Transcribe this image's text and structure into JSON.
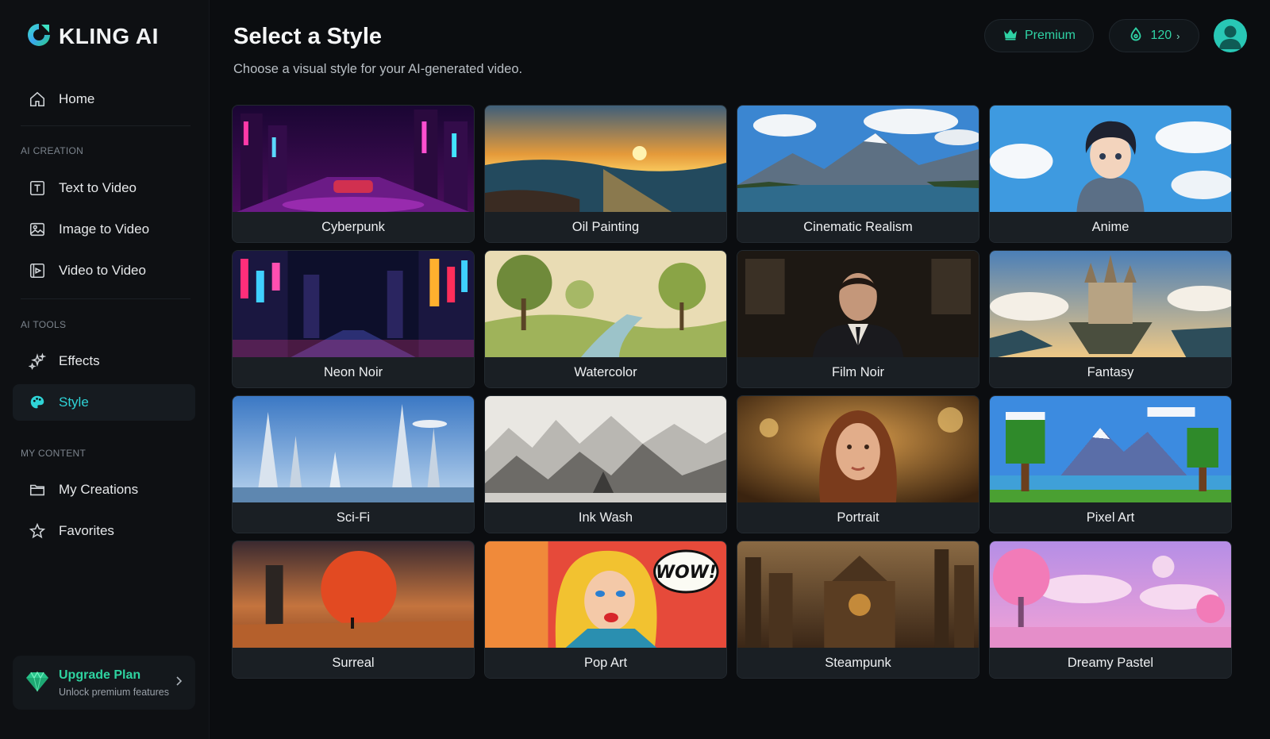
{
  "app": {
    "name": "KLING AI"
  },
  "sidebar": {
    "home": "Home",
    "sections": [
      {
        "label": "AI CREATION",
        "items": [
          "Text to Video",
          "Image to Video",
          "Video to Video"
        ]
      },
      {
        "label": "AI TOOLS",
        "items": [
          "Effects",
          "Style"
        ]
      },
      {
        "label": "MY CONTENT",
        "items": [
          "My Creations",
          "Favorites"
        ]
      }
    ],
    "active_item": "Style",
    "upgrade": {
      "title": "Upgrade Plan",
      "subtitle": "Unlock premium features"
    }
  },
  "header": {
    "title": "Select a Style",
    "subtitle": "Choose a visual style for your AI-generated video.",
    "premium_label": "Premium",
    "credits": "120"
  },
  "styles": [
    "Cyberpunk",
    "Oil Painting",
    "Cinematic Realism",
    "Anime",
    "Neon Noir",
    "Watercolor",
    "Film Noir",
    "Fantasy",
    "Sci-Fi",
    "Ink Wash",
    "Portrait",
    "Pixel Art",
    "Surreal",
    "Pop Art",
    "Steampunk",
    "Dreamy Pastel"
  ],
  "icons": {
    "logo": "kling-logo-icon",
    "home": "home-icon",
    "text_to_video": "text-box-icon",
    "image_to_video": "image-icon",
    "video_to_video": "video-icon",
    "effects": "sparkles-icon",
    "style": "palette-icon",
    "my_creations": "folder-icon",
    "favorites": "star-icon",
    "premium": "crown-icon",
    "credits": "drop-icon",
    "upgrade": "gem-icon"
  },
  "colors": {
    "accent": "#2fd3d6",
    "accent_green": "#2ed3a0",
    "background": "#0b0d10",
    "sidebar": "#0e1013",
    "card_label": "#1a1f24"
  }
}
